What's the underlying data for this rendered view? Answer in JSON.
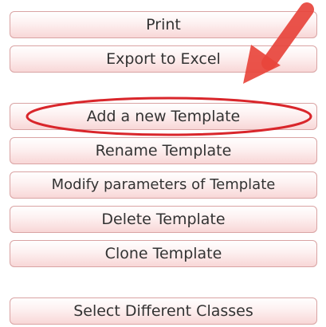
{
  "menu": {
    "buttons": [
      {
        "id": "print",
        "label": "Print"
      },
      {
        "id": "export",
        "label": "Export to Excel"
      },
      {
        "id": "add",
        "label": "Add a new Template"
      },
      {
        "id": "rename",
        "label": "Rename Template"
      },
      {
        "id": "modify",
        "label": "Modify parameters of Template"
      },
      {
        "id": "delete",
        "label": "Delete Template"
      },
      {
        "id": "clone",
        "label": "Clone Template"
      },
      {
        "id": "select",
        "label": "Select Different Classes"
      }
    ]
  },
  "annotation": {
    "highlight_color": "#d9262b",
    "arrow_color": "#e8453c",
    "arrow_icon": "pointer-arrow-icon",
    "highlight_target": "Add a new Template"
  }
}
